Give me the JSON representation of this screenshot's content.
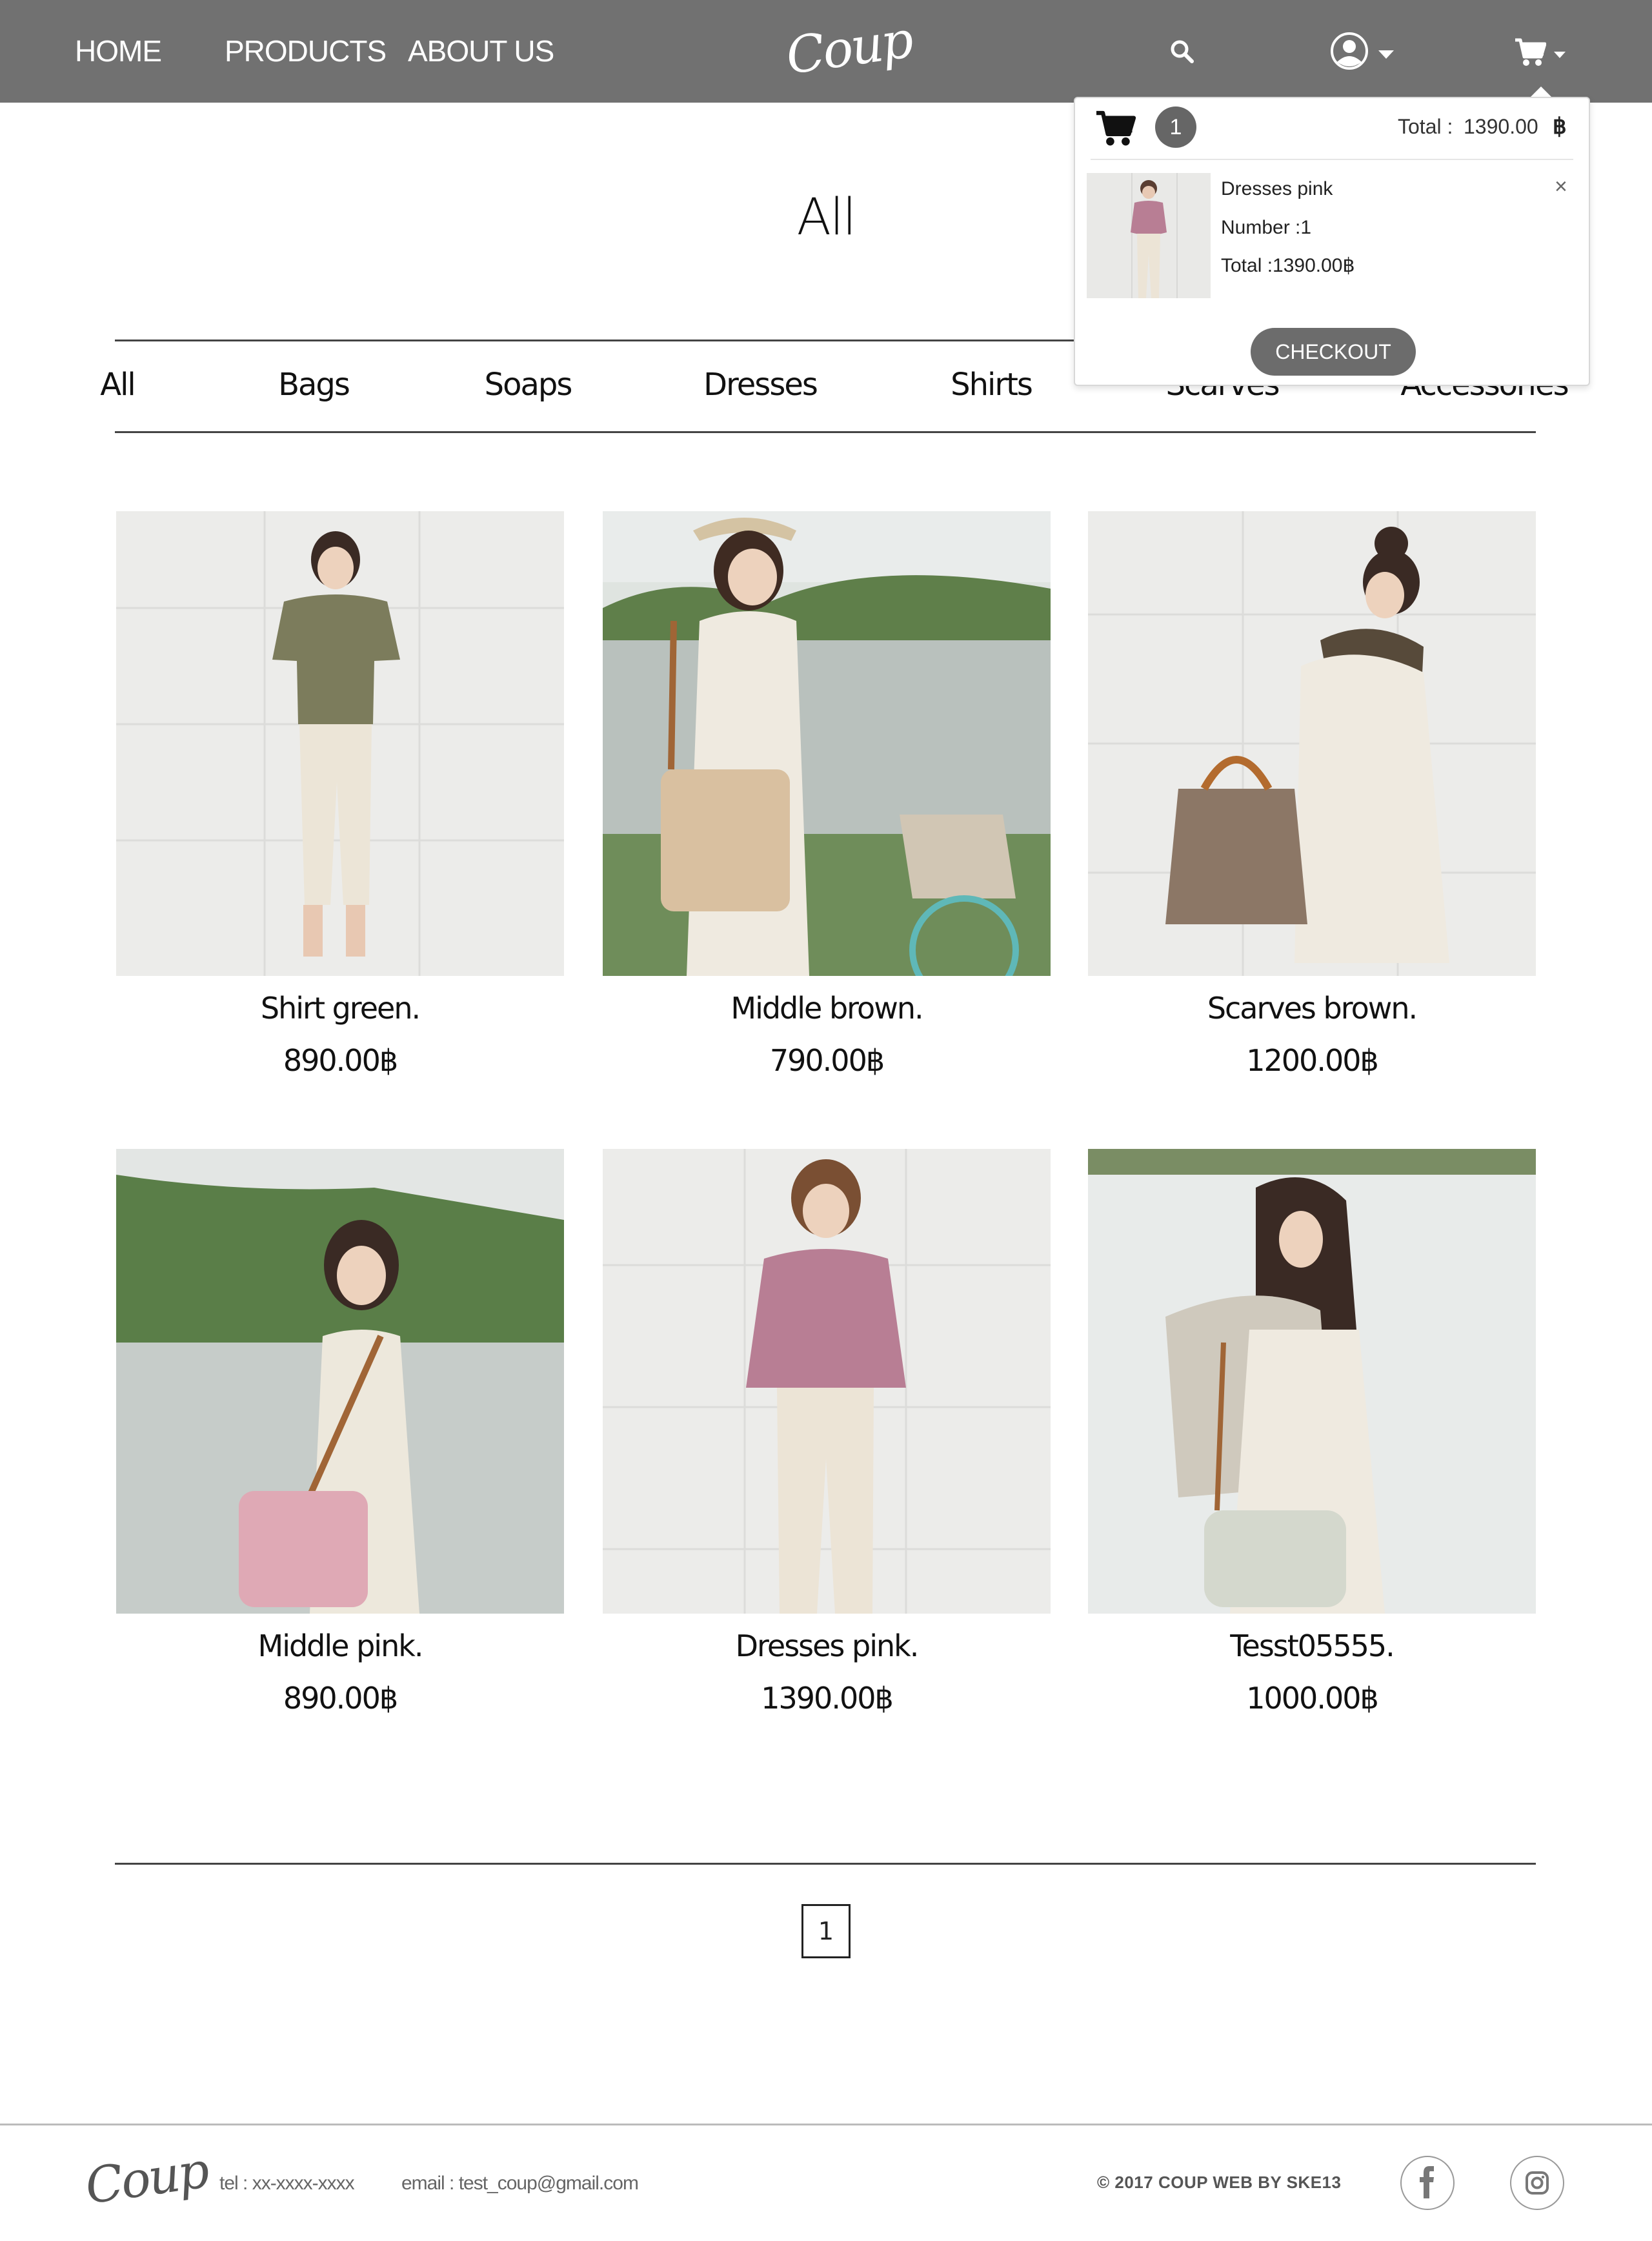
{
  "nav": {
    "home": "HOME",
    "products": "PRODUCTS",
    "about": "ABOUT US",
    "logo": "Coup",
    "icons": [
      "search-icon",
      "user-icon",
      "cart-icon"
    ]
  },
  "cart": {
    "count": "1",
    "total_label": "Total :",
    "total_value": "1390.00",
    "currency": "฿",
    "item_name": "Dresses pink",
    "item_number": "Number :1",
    "item_total": "Total :1390.00฿",
    "remove": "×",
    "checkout": "CHECKOUT"
  },
  "page_title": "All",
  "categories": [
    "All",
    "Bags",
    "Soaps",
    "Dresses",
    "Shirts",
    "Scarves",
    "Accessories"
  ],
  "products": [
    {
      "name": "Shirt green.",
      "price": "890.00฿"
    },
    {
      "name": "Middle brown.",
      "price": "790.00฿"
    },
    {
      "name": "Scarves brown.",
      "price": "1200.00฿"
    },
    {
      "name": "Middle pink.",
      "price": "890.00฿"
    },
    {
      "name": "Dresses pink.",
      "price": "1390.00฿"
    },
    {
      "name": "Tesst05555.",
      "price": "1000.00฿"
    }
  ],
  "pagination": {
    "page": "1"
  },
  "footer": {
    "logo": "Coup",
    "tel": "tel : xx-xxxx-xxxx",
    "email": "email : test_coup@gmail.com",
    "copyright": "© 2017 COUP WEB BY SKE13"
  },
  "colors": {
    "navbar": "#717171",
    "badge": "#666666",
    "checkout": "#6c6c6c"
  }
}
